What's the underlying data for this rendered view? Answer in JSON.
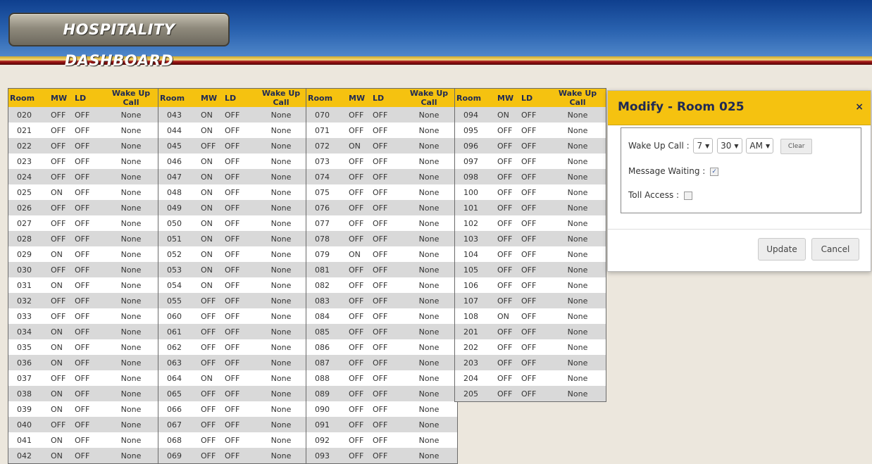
{
  "header": {
    "title": "Hospitality Dashboard",
    "title_display": "HOSPITALITY DASHBOARD"
  },
  "columns": [
    "Room",
    "MW",
    "LD",
    "Wake Up Call"
  ],
  "tables": [
    {
      "rows": [
        [
          "020",
          "OFF",
          "OFF",
          "None"
        ],
        [
          "021",
          "OFF",
          "OFF",
          "None"
        ],
        [
          "022",
          "OFF",
          "OFF",
          "None"
        ],
        [
          "023",
          "OFF",
          "OFF",
          "None"
        ],
        [
          "024",
          "OFF",
          "OFF",
          "None"
        ],
        [
          "025",
          "ON",
          "OFF",
          "None"
        ],
        [
          "026",
          "OFF",
          "OFF",
          "None"
        ],
        [
          "027",
          "OFF",
          "OFF",
          "None"
        ],
        [
          "028",
          "OFF",
          "OFF",
          "None"
        ],
        [
          "029",
          "ON",
          "OFF",
          "None"
        ],
        [
          "030",
          "OFF",
          "OFF",
          "None"
        ],
        [
          "031",
          "ON",
          "OFF",
          "None"
        ],
        [
          "032",
          "OFF",
          "OFF",
          "None"
        ],
        [
          "033",
          "OFF",
          "OFF",
          "None"
        ],
        [
          "034",
          "ON",
          "OFF",
          "None"
        ],
        [
          "035",
          "ON",
          "OFF",
          "None"
        ],
        [
          "036",
          "ON",
          "OFF",
          "None"
        ],
        [
          "037",
          "OFF",
          "OFF",
          "None"
        ],
        [
          "038",
          "ON",
          "OFF",
          "None"
        ],
        [
          "039",
          "ON",
          "OFF",
          "None"
        ],
        [
          "040",
          "OFF",
          "OFF",
          "None"
        ],
        [
          "041",
          "ON",
          "OFF",
          "None"
        ],
        [
          "042",
          "ON",
          "OFF",
          "None"
        ]
      ]
    },
    {
      "rows": [
        [
          "043",
          "ON",
          "OFF",
          "None"
        ],
        [
          "044",
          "ON",
          "OFF",
          "None"
        ],
        [
          "045",
          "OFF",
          "OFF",
          "None"
        ],
        [
          "046",
          "ON",
          "OFF",
          "None"
        ],
        [
          "047",
          "ON",
          "OFF",
          "None"
        ],
        [
          "048",
          "ON",
          "OFF",
          "None"
        ],
        [
          "049",
          "ON",
          "OFF",
          "None"
        ],
        [
          "050",
          "ON",
          "OFF",
          "None"
        ],
        [
          "051",
          "ON",
          "OFF",
          "None"
        ],
        [
          "052",
          "ON",
          "OFF",
          "None"
        ],
        [
          "053",
          "ON",
          "OFF",
          "None"
        ],
        [
          "054",
          "ON",
          "OFF",
          "None"
        ],
        [
          "055",
          "OFF",
          "OFF",
          "None"
        ],
        [
          "060",
          "OFF",
          "OFF",
          "None"
        ],
        [
          "061",
          "OFF",
          "OFF",
          "None"
        ],
        [
          "062",
          "OFF",
          "OFF",
          "None"
        ],
        [
          "063",
          "OFF",
          "OFF",
          "None"
        ],
        [
          "064",
          "ON",
          "OFF",
          "None"
        ],
        [
          "065",
          "OFF",
          "OFF",
          "None"
        ],
        [
          "066",
          "OFF",
          "OFF",
          "None"
        ],
        [
          "067",
          "OFF",
          "OFF",
          "None"
        ],
        [
          "068",
          "OFF",
          "OFF",
          "None"
        ],
        [
          "069",
          "OFF",
          "OFF",
          "None"
        ]
      ]
    },
    {
      "rows": [
        [
          "070",
          "OFF",
          "OFF",
          "None"
        ],
        [
          "071",
          "OFF",
          "OFF",
          "None"
        ],
        [
          "072",
          "ON",
          "OFF",
          "None"
        ],
        [
          "073",
          "OFF",
          "OFF",
          "None"
        ],
        [
          "074",
          "OFF",
          "OFF",
          "None"
        ],
        [
          "075",
          "OFF",
          "OFF",
          "None"
        ],
        [
          "076",
          "OFF",
          "OFF",
          "None"
        ],
        [
          "077",
          "OFF",
          "OFF",
          "None"
        ],
        [
          "078",
          "OFF",
          "OFF",
          "None"
        ],
        [
          "079",
          "ON",
          "OFF",
          "None"
        ],
        [
          "081",
          "OFF",
          "OFF",
          "None"
        ],
        [
          "082",
          "OFF",
          "OFF",
          "None"
        ],
        [
          "083",
          "OFF",
          "OFF",
          "None"
        ],
        [
          "084",
          "OFF",
          "OFF",
          "None"
        ],
        [
          "085",
          "OFF",
          "OFF",
          "None"
        ],
        [
          "086",
          "OFF",
          "OFF",
          "None"
        ],
        [
          "087",
          "OFF",
          "OFF",
          "None"
        ],
        [
          "088",
          "OFF",
          "OFF",
          "None"
        ],
        [
          "089",
          "OFF",
          "OFF",
          "None"
        ],
        [
          "090",
          "OFF",
          "OFF",
          "None"
        ],
        [
          "091",
          "OFF",
          "OFF",
          "None"
        ],
        [
          "092",
          "OFF",
          "OFF",
          "None"
        ],
        [
          "093",
          "OFF",
          "OFF",
          "None"
        ]
      ]
    },
    {
      "rows": [
        [
          "094",
          "ON",
          "OFF",
          "None"
        ],
        [
          "095",
          "OFF",
          "OFF",
          "None"
        ],
        [
          "096",
          "OFF",
          "OFF",
          "None"
        ],
        [
          "097",
          "OFF",
          "OFF",
          "None"
        ],
        [
          "098",
          "OFF",
          "OFF",
          "None"
        ],
        [
          "100",
          "OFF",
          "OFF",
          "None"
        ],
        [
          "101",
          "OFF",
          "OFF",
          "None"
        ],
        [
          "102",
          "OFF",
          "OFF",
          "None"
        ],
        [
          "103",
          "OFF",
          "OFF",
          "None"
        ],
        [
          "104",
          "OFF",
          "OFF",
          "None"
        ],
        [
          "105",
          "OFF",
          "OFF",
          "None"
        ],
        [
          "106",
          "OFF",
          "OFF",
          "None"
        ],
        [
          "107",
          "OFF",
          "OFF",
          "None"
        ],
        [
          "108",
          "ON",
          "OFF",
          "None"
        ],
        [
          "201",
          "OFF",
          "OFF",
          "None"
        ],
        [
          "202",
          "OFF",
          "OFF",
          "None"
        ],
        [
          "203",
          "OFF",
          "OFF",
          "None"
        ],
        [
          "204",
          "OFF",
          "OFF",
          "None"
        ],
        [
          "205",
          "OFF",
          "OFF",
          "None"
        ]
      ]
    }
  ],
  "modal": {
    "title": "Modify - Room 025",
    "close_icon": "×",
    "wake_label": "Wake Up Call :",
    "hour": "7",
    "minute": "30",
    "ampm": "AM",
    "clear_label": "Clear",
    "mw_label": "Message Waiting :",
    "mw_checked": true,
    "toll_label": "Toll Access :",
    "toll_checked": false,
    "update_label": "Update",
    "cancel_label": "Cancel"
  },
  "colors": {
    "on": "#3da64a",
    "off": "#e03a3a",
    "accent": "#f5c210",
    "header": "#1f4f9e"
  }
}
